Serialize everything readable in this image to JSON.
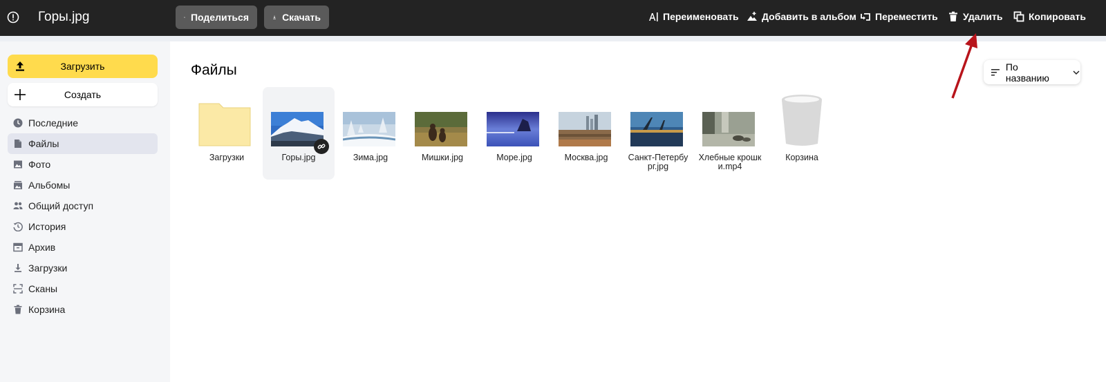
{
  "topbar": {
    "file_title": "Горы.jpg",
    "share_label": "Поделиться",
    "download_label": "Скачать",
    "actions": [
      {
        "label": "Переименовать",
        "icon": "rename-icon"
      },
      {
        "label": "Добавить в альбом",
        "icon": "add-to-album-icon"
      },
      {
        "label": "Переместить",
        "icon": "move-icon"
      },
      {
        "label": "Удалить",
        "icon": "trash-icon"
      },
      {
        "label": "Копировать",
        "icon": "copy-icon"
      }
    ]
  },
  "sidebar": {
    "upload_label": "Загрузить",
    "create_label": "Создать",
    "items": [
      {
        "label": "Последние",
        "icon": "clock-icon"
      },
      {
        "label": "Файлы",
        "icon": "file-icon",
        "active": true
      },
      {
        "label": "Фото",
        "icon": "photo-icon"
      },
      {
        "label": "Альбомы",
        "icon": "album-icon"
      },
      {
        "label": "Общий доступ",
        "icon": "shared-access-icon"
      },
      {
        "label": "История",
        "icon": "history-icon"
      },
      {
        "label": "Архив",
        "icon": "archive-icon"
      },
      {
        "label": "Загрузки",
        "icon": "downloads-icon"
      },
      {
        "label": "Сканы",
        "icon": "scan-icon"
      },
      {
        "label": "Корзина",
        "icon": "trash-icon"
      }
    ]
  },
  "main": {
    "heading": "Файлы",
    "sort_label": "По названию",
    "files": [
      {
        "name": "Загрузки",
        "type": "folder"
      },
      {
        "name": "Горы.jpg",
        "type": "image",
        "selected": true,
        "shared": true
      },
      {
        "name": "Зима.jpg",
        "type": "image"
      },
      {
        "name": "Мишки.jpg",
        "type": "image"
      },
      {
        "name": "Море.jpg",
        "type": "image"
      },
      {
        "name": "Москва.jpg",
        "type": "image"
      },
      {
        "name": "Санкт-Петербург.jpg",
        "type": "image"
      },
      {
        "name": "Хлебные крошки.mp4",
        "type": "video"
      },
      {
        "name": "Корзина",
        "type": "trash"
      }
    ]
  },
  "colors": {
    "topbar_bg": "#232323",
    "accent_yellow": "#ffdb4d",
    "annotation_arrow": "#b8141b"
  }
}
